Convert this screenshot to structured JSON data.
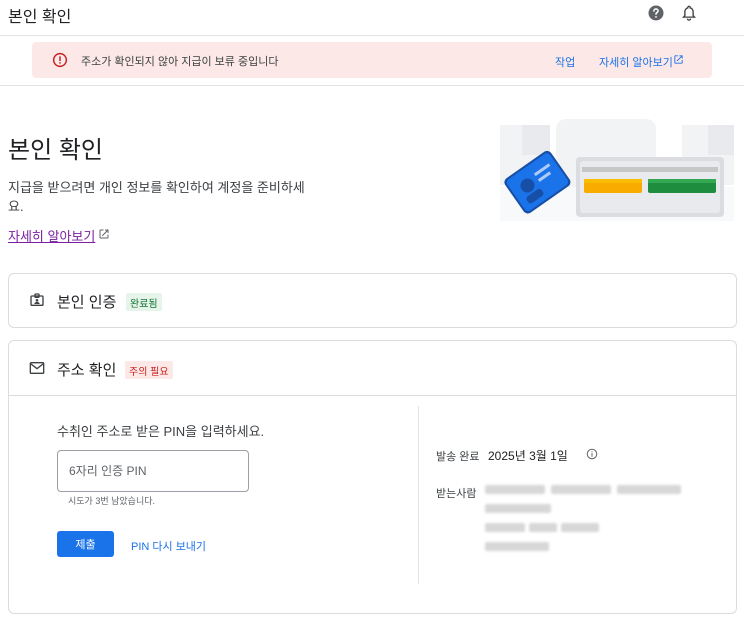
{
  "header": {
    "title": "본인 확인"
  },
  "alert": {
    "message": "주소가 확인되지 않아 지급이 보류 중입니다",
    "action": "작업",
    "learn_more": "자세히 알아보기"
  },
  "intro": {
    "title": "본인 확인",
    "description": "지급을 받으려면 개인 정보를 확인하여 계정을 준비하세요.",
    "learn_more": "자세히 알아보기"
  },
  "identity": {
    "title": "본인 인증",
    "status": "완료됨"
  },
  "address": {
    "title": "주소 확인",
    "status": "주의 필요",
    "prompt": "수취인 주소로 받은 PIN을 입력하세요.",
    "pin_placeholder": "6자리 인증 PIN",
    "attempts": "시도가 3번 남았습니다.",
    "submit": "제출",
    "resend": "PIN 다시 보내기",
    "sent_label": "발송 완료",
    "sent_date": "2025년 3월 1일",
    "from_label": "받는사람"
  },
  "icons": {
    "help": "help-icon",
    "bell": "bell-icon",
    "error": "error-icon",
    "external": "open-in-new-icon",
    "id_card": "id-card-icon",
    "mail": "mail-icon",
    "info": "info-icon"
  },
  "colors": {
    "accent": "#1a73e8",
    "alert_bg": "#fce8e6",
    "success": "#137333",
    "warning": "#c5221f",
    "visited_link": "#7b1fa2"
  }
}
